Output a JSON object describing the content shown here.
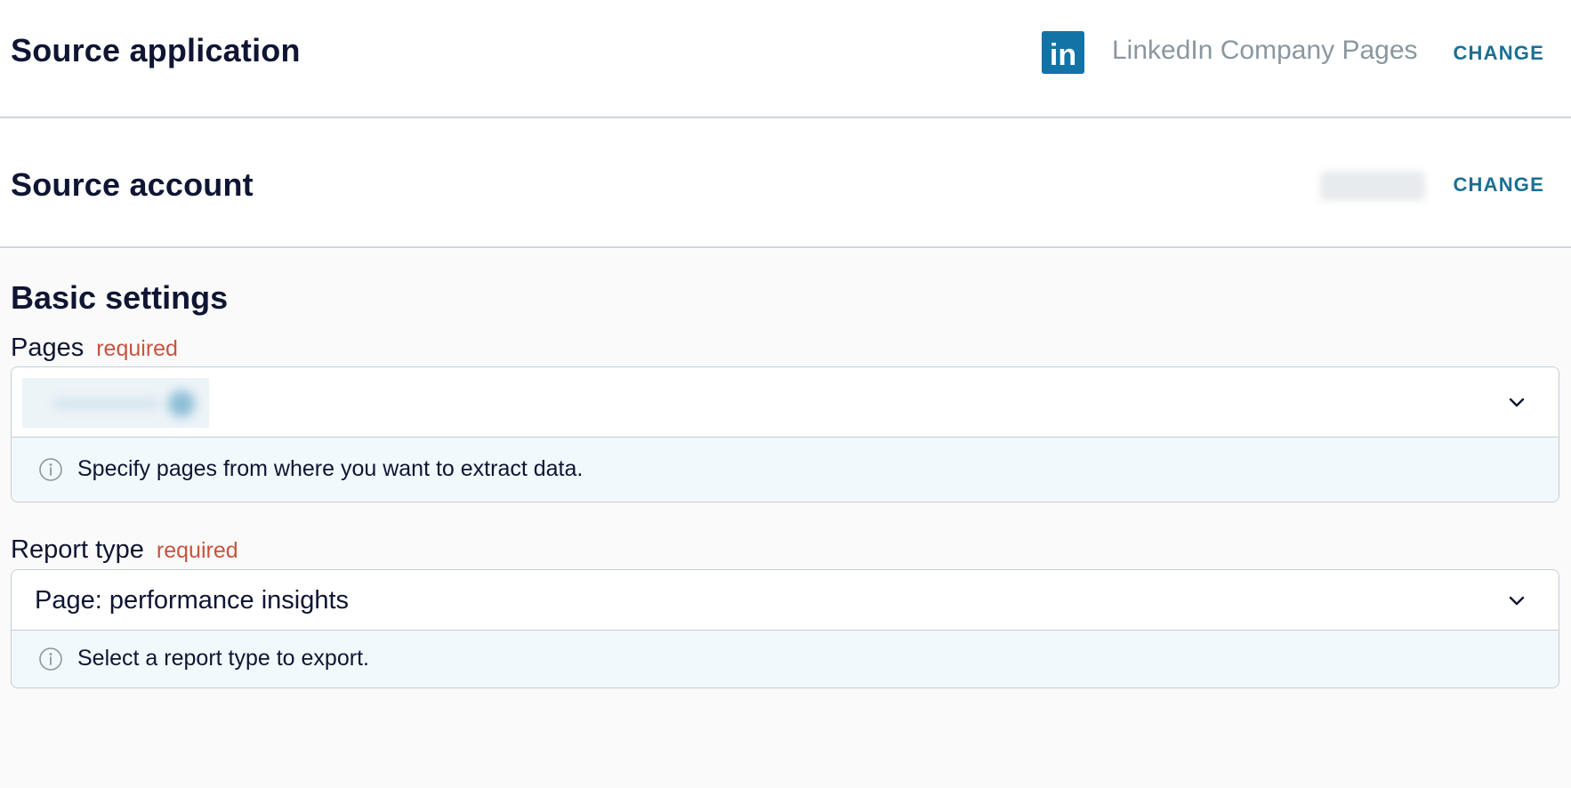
{
  "source_application": {
    "title": "Source application",
    "app_name": "LinkedIn Company Pages",
    "logo_text": "in",
    "change_label": "CHANGE"
  },
  "source_account": {
    "title": "Source account",
    "change_label": "CHANGE"
  },
  "basic_settings": {
    "title": "Basic settings",
    "pages": {
      "label": "Pages",
      "required_label": "required",
      "hint": "Specify pages from where you want to extract data."
    },
    "report_type": {
      "label": "Report type",
      "required_label": "required",
      "selected_value": "Page: performance insights",
      "hint": "Select a report type to export."
    }
  },
  "colors": {
    "accent": "#1a6f93",
    "required": "#c9533f",
    "linkedin_blue": "#1273a7",
    "hint_background": "#f1f9fd"
  },
  "icons": {
    "logo": "linkedin-logo",
    "dropdown": "chevron-down-icon",
    "info": "info-icon"
  }
}
